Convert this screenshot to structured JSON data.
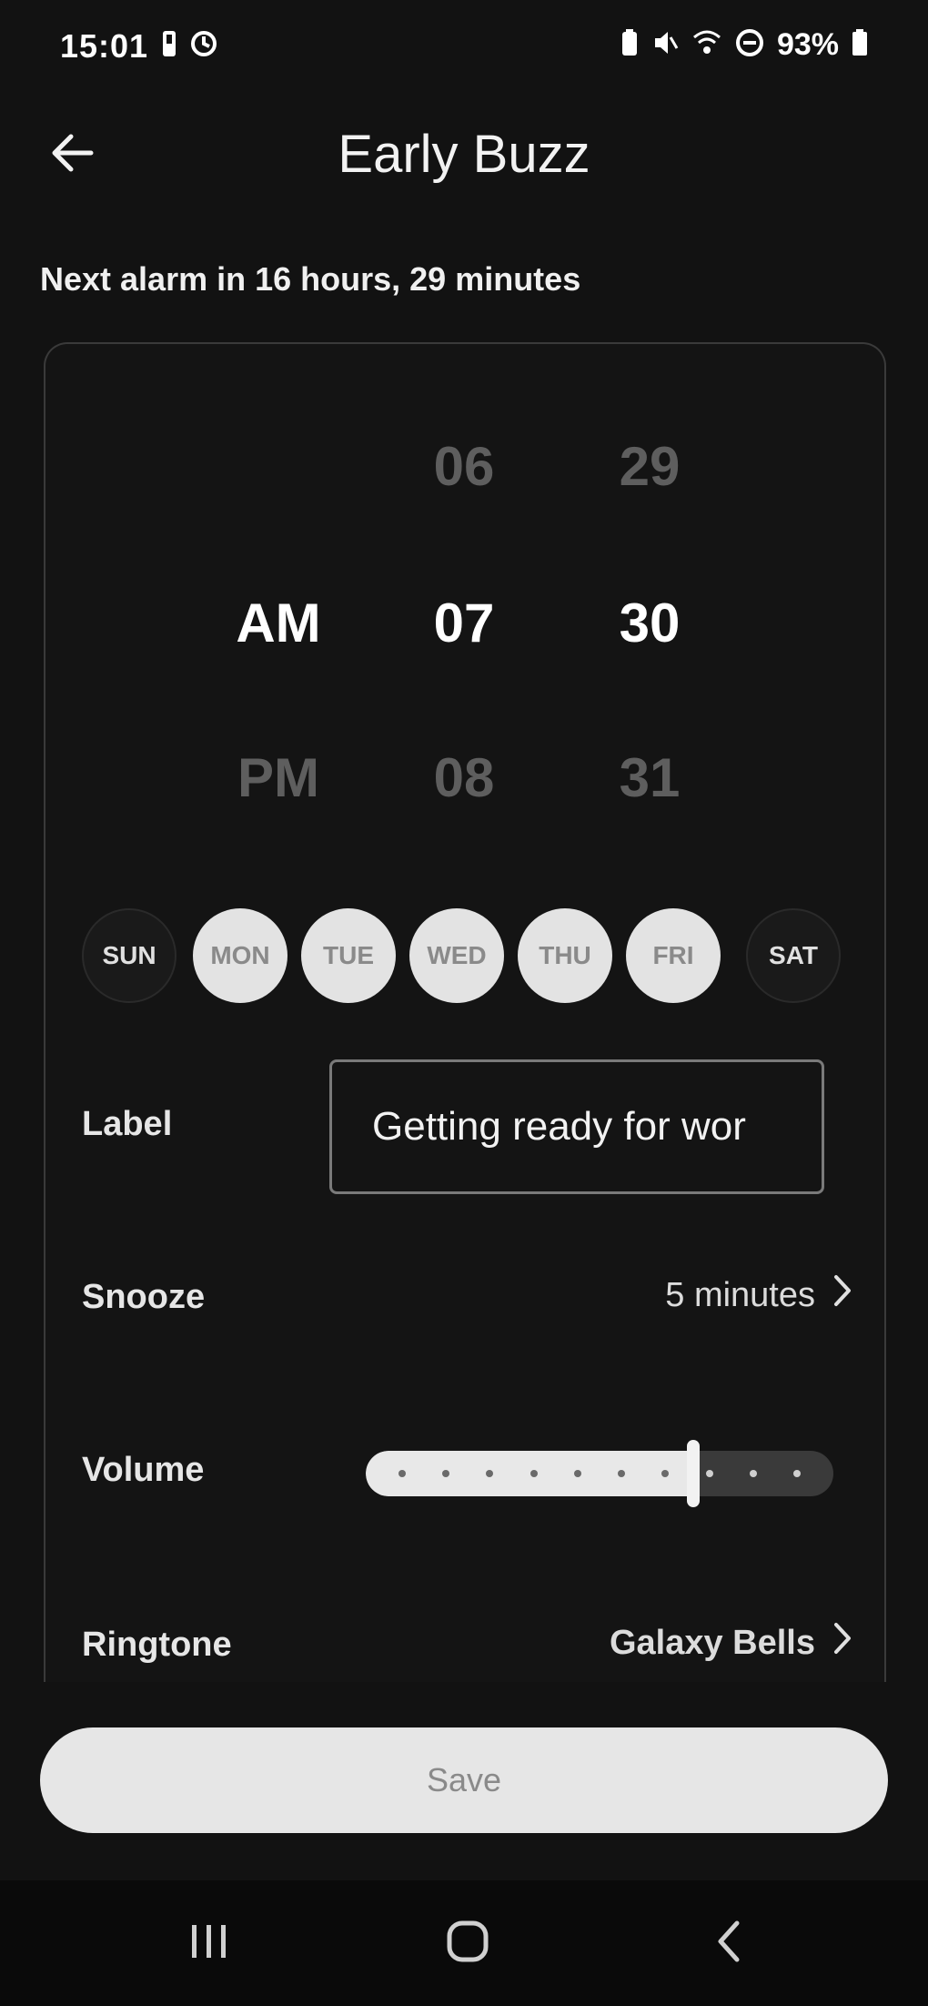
{
  "status_bar": {
    "time": "15:01",
    "battery": "93%",
    "left_icons": [
      "upload-icon",
      "sync-icon"
    ],
    "right_icons": [
      "battery-saver-icon",
      "mute-icon",
      "wifi-call-icon",
      "do-not-disturb-icon"
    ]
  },
  "header": {
    "title": "Early Buzz",
    "back_icon": "arrow-back-icon"
  },
  "next_alarm": "Next alarm in 16 hours, 29 minutes",
  "time_picker": {
    "ampm": {
      "selected": "AM",
      "below": "PM"
    },
    "hour": {
      "above": "06",
      "selected": "07",
      "below": "08"
    },
    "minute": {
      "above": "29",
      "selected": "30",
      "below": "31"
    }
  },
  "days": [
    {
      "label": "SUN",
      "selected": false
    },
    {
      "label": "MON",
      "selected": true
    },
    {
      "label": "TUE",
      "selected": true
    },
    {
      "label": "WED",
      "selected": true
    },
    {
      "label": "THU",
      "selected": true
    },
    {
      "label": "FRI",
      "selected": true
    },
    {
      "label": "SAT",
      "selected": false
    }
  ],
  "label_row": {
    "label": "Label",
    "value": "Getting ready for wor"
  },
  "snooze_row": {
    "label": "Snooze",
    "value": "5 minutes"
  },
  "volume_row": {
    "label": "Volume",
    "level": 0.7,
    "steps": 10
  },
  "ringtone_row": {
    "label": "Ringtone",
    "value": "Galaxy Bells"
  },
  "save_button": "Save",
  "nav": {
    "recents_icon": "recents-icon",
    "home_icon": "home-icon",
    "back_icon": "nav-back-icon"
  },
  "colors": {
    "background": "#121212",
    "chip_selected": "#e3e3e3",
    "accent_text": "#ffffff",
    "dim_text": "#5e5e5e"
  }
}
